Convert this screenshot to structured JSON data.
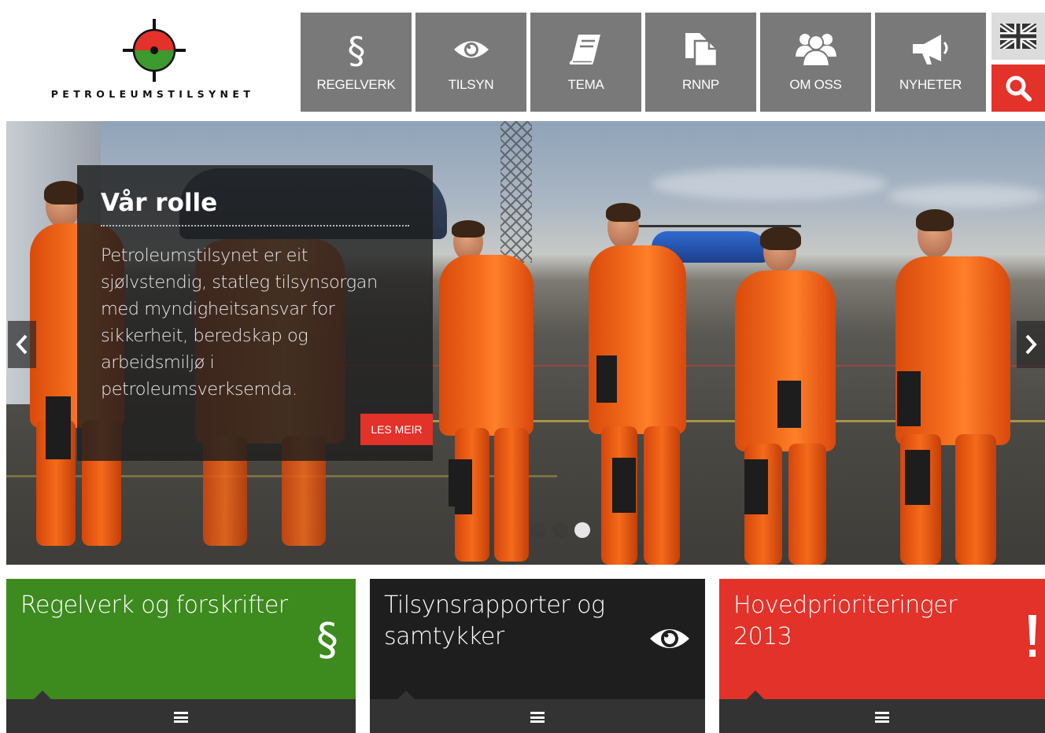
{
  "header": {
    "logo_text": "PETROLEUMSTILSYNET",
    "nav": [
      {
        "label": "REGELVERK",
        "icon": "section-icon"
      },
      {
        "label": "TILSYN",
        "icon": "eye-icon"
      },
      {
        "label": "TEMA",
        "icon": "book-icon"
      },
      {
        "label": "RNNP",
        "icon": "documents-icon"
      },
      {
        "label": "OM OSS",
        "icon": "group-icon"
      },
      {
        "label": "NYHETER",
        "icon": "megaphone-icon"
      }
    ],
    "language_icon": "uk-flag-icon",
    "search_icon": "search-icon"
  },
  "hero": {
    "title": "Vår rolle",
    "text": "Petroleumstilsynet er eit sjølvstendig, statleg tilsynsorgan med myndigheitsansvar for sikkerheit, beredskap og arbeidsmiljø i petroleumsverksemda.",
    "button": "LES MEIR",
    "slides": 3,
    "active_slide": 3
  },
  "tiles": [
    {
      "title": "Regelverk og forskrifter",
      "color": "#3d8a1e",
      "icon": "section-icon"
    },
    {
      "title": "Tilsynsrapporter og samtykker",
      "color": "#1e1e1e",
      "icon": "eye-icon"
    },
    {
      "title": "Hovedprioriteringer 2013",
      "color": "#e2322a",
      "icon": "exclamation-icon"
    }
  ],
  "colors": {
    "nav_bg": "#797979",
    "accent_red": "#e2322a",
    "tile_footer": "#333333"
  }
}
